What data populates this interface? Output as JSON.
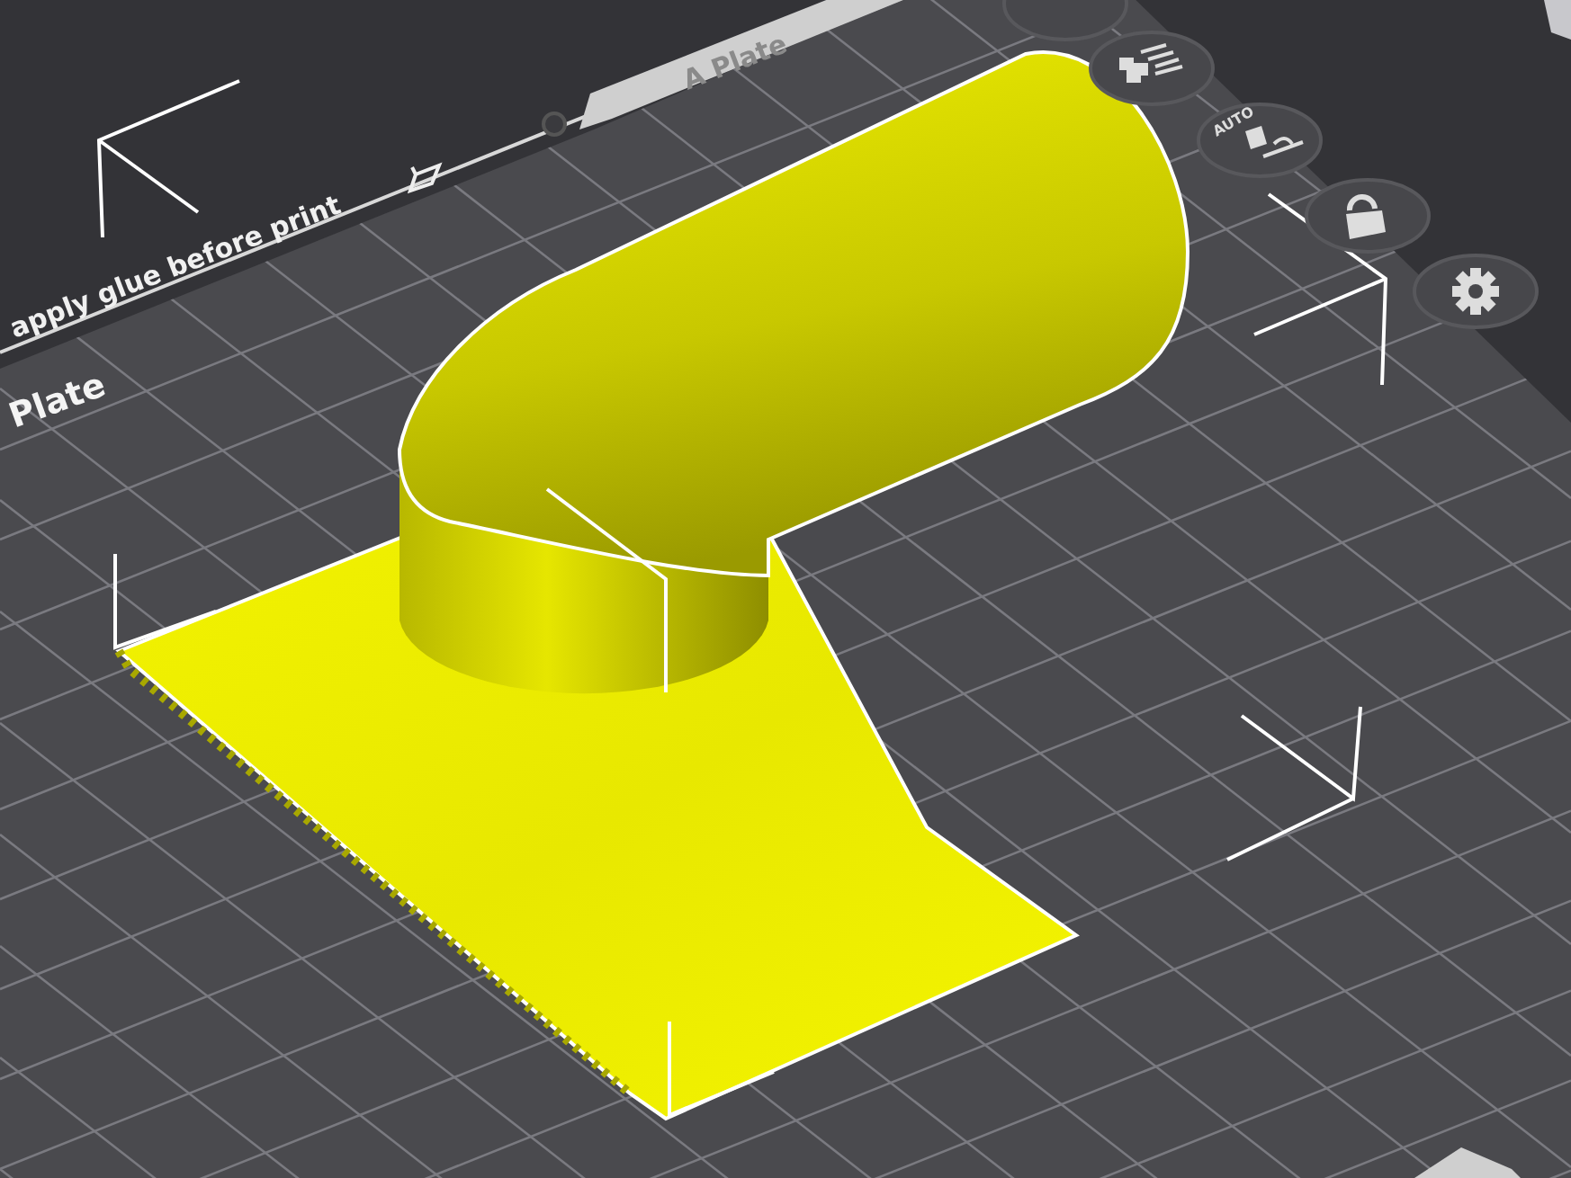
{
  "plate": {
    "tab_label": "A Plate",
    "notice": "apply glue before print",
    "name": "Plate"
  },
  "toolbar": [
    {
      "kind": "partial"
    },
    {
      "kind": "layout"
    },
    {
      "kind": "auto",
      "label": "AUTO"
    },
    {
      "kind": "lock"
    },
    {
      "kind": "settings"
    }
  ]
}
